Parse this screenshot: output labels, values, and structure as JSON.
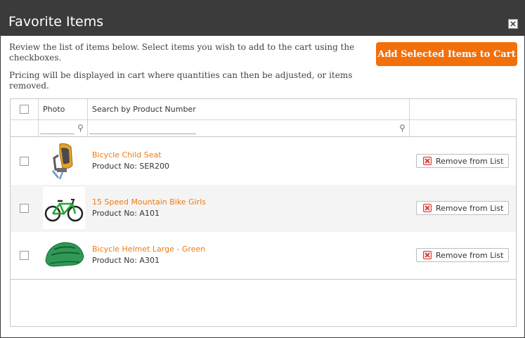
{
  "dialog": {
    "title": "Favorite Items",
    "close_label": "×"
  },
  "intro": {
    "line1": "Review the list of items below. Select items you wish to add to the cart using the checkboxes.",
    "line2": "Pricing will be displayed in cart where quantities can then be adjusted, or items removed."
  },
  "actions": {
    "add_selected_label": "Add Selected Items to Cart"
  },
  "table": {
    "columns": [
      "",
      "Photo",
      "Search by Product Number",
      ""
    ],
    "filters": {
      "photo_value": "",
      "product_value": ""
    },
    "rows": [
      {
        "name": "Bicycle Child Seat",
        "product_no": "Product No: SER200",
        "remove_label": "Remove from List",
        "image": "child-seat-image",
        "checked": false
      },
      {
        "name": "15 Speed Mountain Bike Girls",
        "product_no": "Product No: A101",
        "remove_label": "Remove from List",
        "image": "green-bike-image",
        "checked": false
      },
      {
        "name": "Bicycle Helmet Large - Green",
        "product_no": "Product No: A301",
        "remove_label": "Remove from List",
        "image": "green-helmet-image",
        "checked": false
      }
    ]
  },
  "colors": {
    "titlebar": "#3b3b3b",
    "accent": "#f26f0a",
    "link": "#f07a10",
    "remove_icon": "#d9342b"
  }
}
